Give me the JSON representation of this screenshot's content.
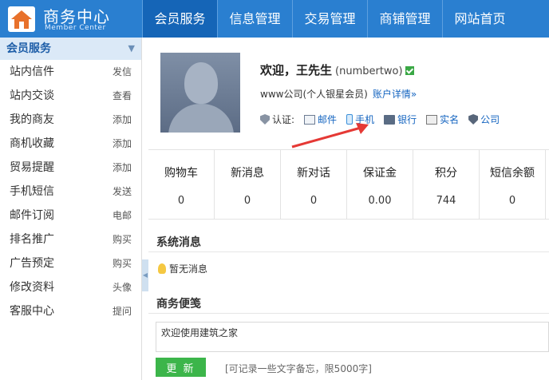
{
  "header": {
    "title": "商务中心",
    "subtitle": "Member Center",
    "nav": [
      {
        "label": "会员服务",
        "active": true
      },
      {
        "label": "信息管理",
        "active": false
      },
      {
        "label": "交易管理",
        "active": false
      },
      {
        "label": "商铺管理",
        "active": false
      },
      {
        "label": "网站首页",
        "active": false
      }
    ]
  },
  "sidebar": {
    "section_title": "会员服务",
    "items": [
      {
        "label": "站内信件",
        "action": "发信"
      },
      {
        "label": "站内交谈",
        "action": "查看"
      },
      {
        "label": "我的商友",
        "action": "添加"
      },
      {
        "label": "商机收藏",
        "action": "添加"
      },
      {
        "label": "贸易提醒",
        "action": "添加"
      },
      {
        "label": "手机短信",
        "action": "发送"
      },
      {
        "label": "邮件订阅",
        "action": "电邮"
      },
      {
        "label": "排名推广",
        "action": "购买"
      },
      {
        "label": "广告预定",
        "action": "购买"
      },
      {
        "label": "修改资料",
        "action": "头像"
      },
      {
        "label": "客服中心",
        "action": "提问"
      }
    ]
  },
  "profile": {
    "welcome": "欢迎，王先生",
    "username": "(numbertwo)",
    "company": "www公司(个人银星会员)",
    "account_link": "账户详情»",
    "cert_label": "认证:",
    "certs": [
      "邮件",
      "手机",
      "银行",
      "实名",
      "公司"
    ]
  },
  "stats": [
    {
      "label": "购物车",
      "value": "0"
    },
    {
      "label": "新消息",
      "value": "0"
    },
    {
      "label": "新对话",
      "value": "0"
    },
    {
      "label": "保证金",
      "value": "0.00"
    },
    {
      "label": "积分",
      "value": "744"
    },
    {
      "label": "短信余额",
      "value": "0"
    }
  ],
  "system_messages": {
    "title": "系统消息",
    "empty_text": "暂无消息"
  },
  "memo": {
    "title": "商务便笺",
    "content": "欢迎使用建筑之家",
    "button": "更 新",
    "hint": "[可记录一些文字备忘，限5000字]"
  },
  "colors": {
    "primary": "#2a7fd0",
    "nav_active": "#1565b7",
    "link": "#1565c0",
    "button": "#3cb54a",
    "arrow": "#e53935"
  }
}
